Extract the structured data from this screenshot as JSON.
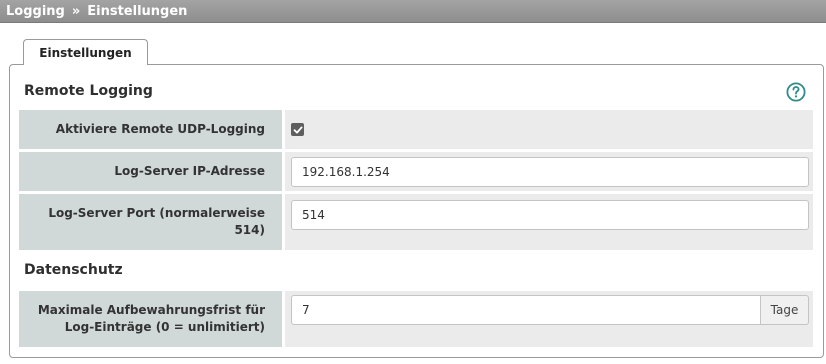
{
  "breadcrumb": {
    "parent": "Logging",
    "separator": "»",
    "current": "Einstellungen"
  },
  "tabs": [
    {
      "label": "Einstellungen",
      "active": true
    }
  ],
  "sections": {
    "remote_logging": {
      "title": "Remote Logging",
      "help_icon": "question-circle-icon",
      "fields": {
        "udp": {
          "label": "Aktiviere Remote UDP-Logging",
          "checked": true
        },
        "ip": {
          "label": "Log-Server IP-Adresse",
          "value": "192.168.1.254"
        },
        "port": {
          "label_line1": "Log-Server Port (normalerweise",
          "label_line2": "514)",
          "value": "514"
        }
      }
    },
    "datenschutz": {
      "title": "Datenschutz",
      "fields": {
        "retention": {
          "label_line1": "Maximale Aufbewahrungsfrist für",
          "label_line2": "Log-Einträge (0 = unlimitiert)",
          "value": "7",
          "unit": "Tage"
        }
      }
    }
  },
  "colors": {
    "accent": "#2e8b8b",
    "label_bg": "#d1d9d8",
    "value_bg": "#ebebeb",
    "titlebar": "#999999"
  }
}
